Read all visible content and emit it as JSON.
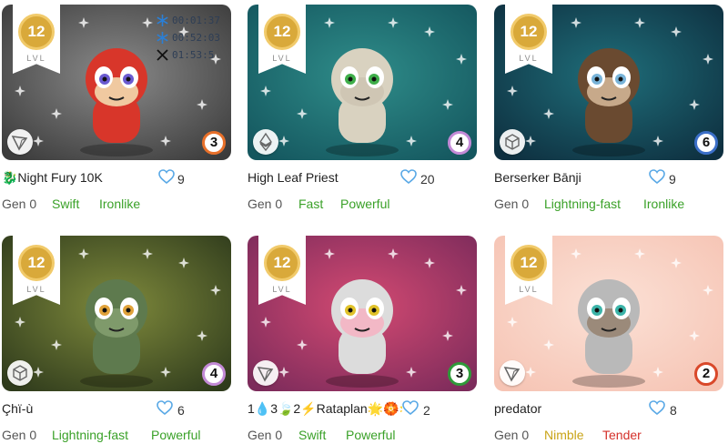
{
  "level_caption": "LVL",
  "cards": [
    {
      "level": "12",
      "name": "🐉Night Fury 10K",
      "likes": "9",
      "count": "3",
      "chain": "tron",
      "gen": "Gen 0",
      "trait1": "Swift",
      "trait2": "Ironlike",
      "timers": [
        "00:01:37",
        "00:52:03",
        "01:53:5"
      ],
      "colors": {
        "bg1": "#8a8a8a",
        "bg2": "#3b3b3b",
        "count_border": "#e8702a",
        "trait1": "#3aa128",
        "trait2": "#3aa128"
      }
    },
    {
      "level": "12",
      "name": "High Leaf Priest",
      "likes": "20",
      "count": "4",
      "chain": "ethereum",
      "gen": "Gen 0",
      "trait1": "Fast",
      "trait2": "Powerful",
      "colors": {
        "bg1": "#2f8d8a",
        "bg2": "#14565e",
        "count_border": "#c38ad6",
        "trait1": "#3aa128",
        "trait2": "#3aa128"
      }
    },
    {
      "level": "12",
      "name": "Berserker Bānji",
      "likes": "9",
      "count": "6",
      "chain": "cube",
      "gen": "Gen 0",
      "trait1": "Lightning-fast",
      "trait2": "Ironlike",
      "colors": {
        "bg1": "#1f6e7a",
        "bg2": "#0e2f3f",
        "count_border": "#3b6fc8",
        "trait1": "#3aa128",
        "trait2": "#3aa128"
      }
    },
    {
      "level": "12",
      "name": "Çhï-ù",
      "likes": "6",
      "count": "4",
      "chain": "cube",
      "gen": "Gen 0",
      "trait1": "Lightning-fast",
      "trait2": "Powerful",
      "colors": {
        "bg1": "#7f8a3c",
        "bg2": "#2f3b1c",
        "count_border": "#c38ad6",
        "trait1": "#3aa128",
        "trait2": "#3aa128"
      }
    },
    {
      "level": "12",
      "name": "1💧3🍃2⚡Rataplan🌟🏵️🌟",
      "likes": "2",
      "count": "3",
      "chain": "tron",
      "gen": "Gen 0",
      "trait1": "Swift",
      "trait2": "Powerful",
      "colors": {
        "bg1": "#d44a72",
        "bg2": "#7c2b5b",
        "count_border": "#2f9a3a",
        "trait1": "#3aa128",
        "trait2": "#3aa128"
      }
    },
    {
      "level": "12",
      "name": "predator",
      "likes": "8",
      "count": "2",
      "chain": "tron",
      "gen": "Gen 0",
      "trait1": "Nimble",
      "trait2": "Tender",
      "colors": {
        "bg1": "#fbe1d6",
        "bg2": "#f6c4b4",
        "count_border": "#d9482a",
        "trait1": "#c9a417",
        "trait2": "#d4302a"
      }
    }
  ]
}
